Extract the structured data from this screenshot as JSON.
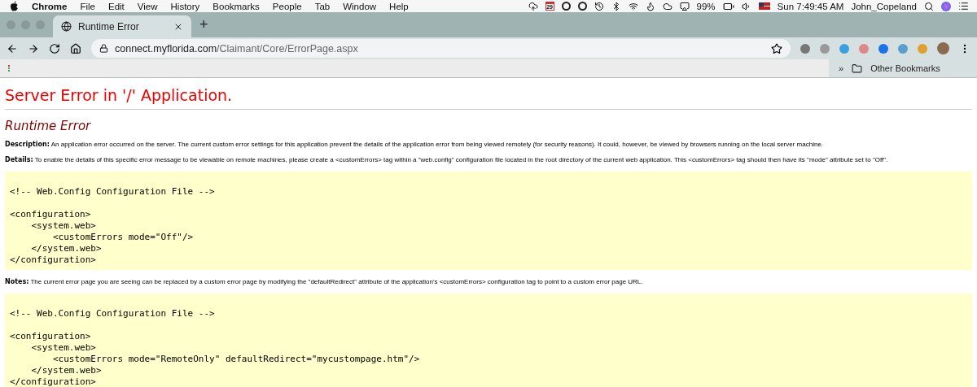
{
  "menu_bar": {
    "app": "Chrome",
    "menus": [
      "File",
      "Edit",
      "View",
      "History",
      "Bookmarks",
      "People",
      "Tab",
      "Window",
      "Help"
    ],
    "calendar_day": "29",
    "battery": "99%",
    "clock": "Sun 7:49:45 AM",
    "user": "John_Copeland"
  },
  "tabs": [
    {
      "title": "Runtime Error",
      "selected": true
    }
  ],
  "new_tab": "+",
  "address_bar": {
    "domain": "connect.myflorida.com",
    "path": "/Claimant/Core/ErrorPage.aspx"
  },
  "bookmarks_bar": {
    "overflow": "»",
    "folder": "Other Bookmarks"
  },
  "page": {
    "heading": "Server Error in '/' Application.",
    "subheading": "Runtime Error",
    "sections": [
      {
        "kind": "paragraph",
        "text": "**Description:** An application error occurred on the server. The current custom error settings for this application prevent the details of the application error from being viewed remotely (for security reasons). It could, however, be viewed by browsers running on the local server machine."
      },
      {
        "kind": "paragraph",
        "text": "**Details:** To enable the details of this specific error message to be viewable on remote machines, please create a <customErrors> tag within a \"web.config\" configuration file located in the root directory of the current web application. This <customErrors> tag should then have its \"mode\" attribute set to \"Off\"."
      },
      {
        "kind": "code",
        "text": "<!-- Web.Config Configuration File -->\n\n<configuration>\n    <system.web>\n        <customErrors mode=\"Off\"/>\n    </system.web>\n</configuration>"
      },
      {
        "kind": "paragraph",
        "text": "**Notes:** The current error page you are seeing can be replaced by a custom error page by modifying the \"defaultRedirect\" attribute of the application's <customErrors> configuration tag to point to a custom error page URL."
      },
      {
        "kind": "code",
        "text": "<!-- Web.Config Configuration File -->\n\n<configuration>\n    <system.web>\n        <customErrors mode=\"RemoteOnly\" defaultRedirect=\"mycustompage.htm\"/>\n    </system.web>\n</configuration>"
      }
    ]
  }
}
